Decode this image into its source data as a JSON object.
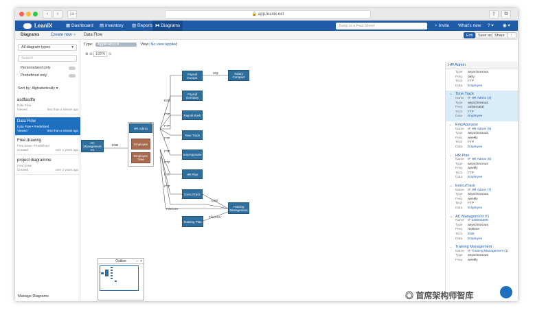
{
  "browser": {
    "url": "app.leanix.net"
  },
  "app": {
    "brand": "LeanIX",
    "nav": [
      {
        "label": "Dashboard"
      },
      {
        "label": "Inventory"
      },
      {
        "label": "Reports"
      },
      {
        "label": "Diagrams"
      }
    ],
    "search_placeholder": "Jump to a Fact Sheet",
    "invite": "+ Invite",
    "whats_new": "What's new",
    "help": "?"
  },
  "toolbar": {
    "section": "Diagrams",
    "create_new": "Create new",
    "current": "Data Flow",
    "edit": "Edit",
    "save_as": "Save as",
    "share": "Share",
    "more": "⋮"
  },
  "sidebar": {
    "filter": "All diagram types",
    "search": "Search",
    "personalized": "Personalized only",
    "predefined": "Predefined only",
    "sort": "Sort by: Alphabetically",
    "items": [
      {
        "title": "asdfasdfa",
        "sub": "Data Flow",
        "status": "Viewed",
        "time": "less than a minute ago"
      },
      {
        "title": "Data Flow",
        "sub": "Data Flow • Predefined",
        "status": "Viewed",
        "time": "less than a minute ago"
      },
      {
        "title": "Free drawing",
        "sub": "Free Draw • Predefined",
        "status": "Created",
        "time": "over 2 years ago"
      },
      {
        "title": "project diagramme",
        "sub": "Free Draw",
        "status": "Created",
        "time": "over 2 years ago"
      }
    ],
    "footer": "Manage Diagrams"
  },
  "canvas": {
    "type_label": "Type:",
    "type_value": "Application",
    "view_label": "View:",
    "view_value": "No view applied",
    "zoom": "100%",
    "nodes": {
      "ac": "AC Management V1",
      "hr": "HR Admin",
      "emp": "Employee",
      "emptime": "Employee Time",
      "pe": "Payroll Europe",
      "sc": "Salary Compact",
      "pg": "Payroll Germany",
      "prow": "Payroll RoW",
      "tt": "Time Track",
      "ea": "EmpAppraise",
      "hrp": "HR Plan",
      "et": "ExecuTrack",
      "tm": "Training Management",
      "tp": "Training Plan"
    },
    "edge_labels": {
      "esb": "ESB",
      "mq": "MQ",
      "ftp": "FTP",
      "filecsv": "File/CSV"
    },
    "outline_title": "Outline"
  },
  "panel": {
    "title": "HR Admin",
    "top": {
      "type": "asynchronous",
      "freq": "daily",
      "tech": "FTP",
      "data": "Employee"
    },
    "items": [
      {
        "name": "Time Track",
        "if": "IF HR Admin (4)",
        "type": "asynchronous",
        "freq": "onDemand",
        "tech": "FTP",
        "data": "Employee"
      },
      {
        "name": "EmpAppraise",
        "if": "IF HR Admin (5)",
        "type": "asynchronous",
        "freq": "weekly",
        "tech": "FTP",
        "data": "Employee"
      },
      {
        "name": "HR Plan",
        "if": "IF HR Admin (6)",
        "type": "asynchronous",
        "freq": "weekly",
        "tech": "FTP",
        "data": "Employee"
      },
      {
        "name": "ExecuTrack",
        "if": "IF HR Admin (7)",
        "type": "asynchronous",
        "freq": "weekly",
        "tech": "FTP",
        "data": "Employee"
      },
      {
        "name": "AC Management V1",
        "if": "IF 240000288",
        "type": "asynchronous",
        "freq": "realtime",
        "tech": "ESB",
        "data": "Employee"
      },
      {
        "name": "Training Management",
        "if": "IF Training Management (1)",
        "type": "asynchronous",
        "freq": "weekly",
        "tech": "",
        "data": ""
      }
    ],
    "keys": {
      "name": "Name",
      "type": "Type",
      "freq": "Freq",
      "tech": "Tech",
      "data": "Data"
    }
  },
  "watermark": "首席架构师智库"
}
